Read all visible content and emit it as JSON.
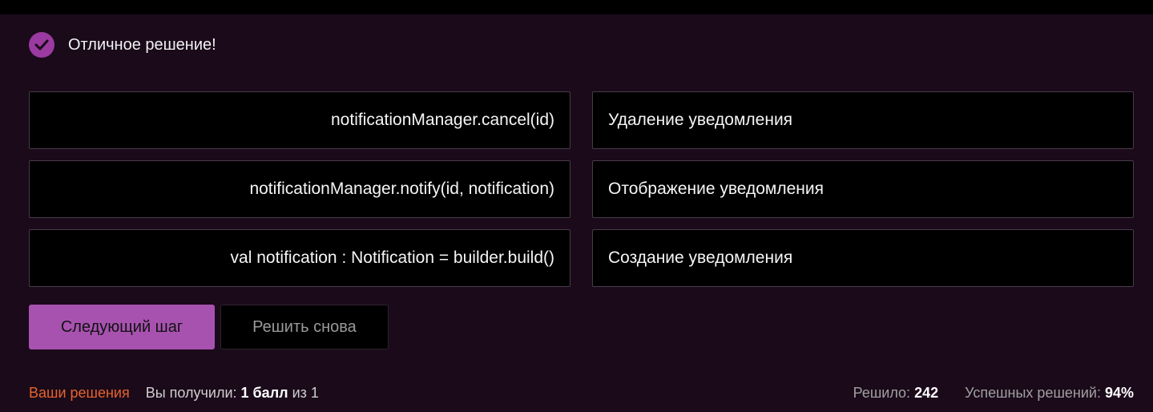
{
  "result": {
    "icon": "check-circle-icon",
    "message": "Отличное решение!"
  },
  "pairs": [
    {
      "code": "notificationManager.cancel(id)",
      "meaning": "Удаление уведомления"
    },
    {
      "code": "notificationManager.notify(id, notification)",
      "meaning": "Отображение уведомления"
    },
    {
      "code": "val notification : Notification = builder.build()",
      "meaning": "Создание уведомления"
    }
  ],
  "actions": {
    "next_label": "Следующий шаг",
    "retry_label": "Решить снова"
  },
  "footer": {
    "solutions_link": "Ваши решения",
    "score_prefix": "Вы получили: ",
    "score_value": "1 балл",
    "score_suffix": " из 1",
    "solved_label": "Решило: ",
    "solved_value": "242",
    "success_label": "Успешных решений: ",
    "success_value": "94%"
  },
  "colors": {
    "background": "#1a0a1a",
    "accent": "#a852b0",
    "link": "#e8632b"
  }
}
